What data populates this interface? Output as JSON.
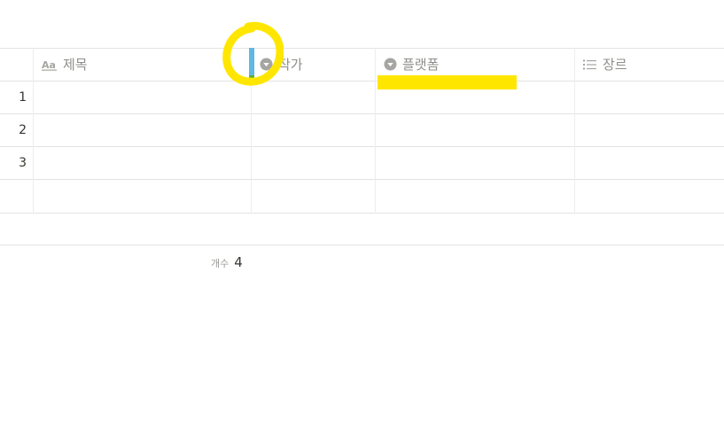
{
  "columns": [
    {
      "name": "제목",
      "icon": "text-type-icon"
    },
    {
      "name": "작가",
      "icon": "select-dropdown-icon"
    },
    {
      "name": "플랫폼",
      "icon": "select-dropdown-icon"
    },
    {
      "name": "장르",
      "icon": "multi-select-list-icon"
    }
  ],
  "rows": [
    {
      "number": "1"
    },
    {
      "number": "2"
    },
    {
      "number": "3"
    },
    {
      "number": ""
    }
  ],
  "footer": {
    "count_label": "개수",
    "count_value": "4"
  },
  "colors": {
    "annotation_yellow": "#ffe600",
    "resize_handle_blue": "#5fb8e2",
    "resize_handle_green": "#5cb030",
    "grid_line": "#e3e3e1",
    "header_text": "#8e8e8a"
  }
}
